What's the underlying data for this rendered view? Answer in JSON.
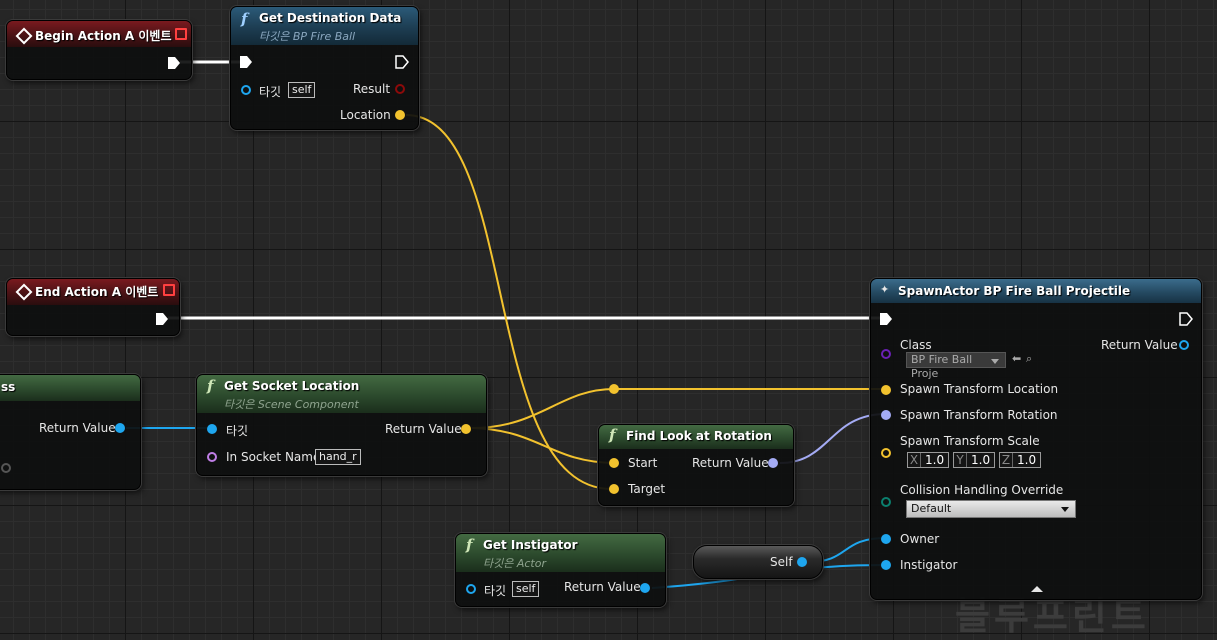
{
  "colors": {
    "exec": "#ffffff",
    "vector": "#f2c22e",
    "rotator": "#a4abf4",
    "object": "#1ea6ef",
    "string": "#c07ee6",
    "class": "#6a20b6",
    "enum": "#0b7f6e",
    "boolean": "#8c0a0a"
  },
  "nodes": {
    "begin_event": {
      "title": "Begin Action A 이벤트"
    },
    "get_destination": {
      "title": "Get Destination Data",
      "subtitle": "타깃은 BP Fire Ball",
      "target_label": "타깃",
      "target_value": "self",
      "result_label": "Result",
      "location_label": "Location"
    },
    "end_event": {
      "title": "End Action A 이벤트"
    },
    "partial": {
      "title": "ss",
      "return_label": "Return Value"
    },
    "get_socket": {
      "title": "Get Socket Location",
      "subtitle": "타깃은 Scene Component",
      "target_label": "타깃",
      "socket_label": "In Socket Name",
      "socket_value": "hand_r",
      "return_label": "Return Value"
    },
    "find_look": {
      "title": "Find Look at Rotation",
      "start_label": "Start",
      "target_label": "Target",
      "return_label": "Return Value"
    },
    "get_instigator": {
      "title": "Get Instigator",
      "subtitle": "타깃은 Actor",
      "target_label": "타깃",
      "target_value": "self",
      "return_label": "Return Value"
    },
    "self_node": {
      "label": "Self"
    },
    "spawn": {
      "title": "SpawnActor BP Fire Ball Projectile",
      "class_label": "Class",
      "class_value": "BP Fire Ball Proje",
      "return_label": "Return Value",
      "location_label": "Spawn Transform Location",
      "rotation_label": "Spawn Transform Rotation",
      "scale_label": "Spawn Transform Scale",
      "scale": {
        "x_label": "X",
        "x": "1.0",
        "y_label": "Y",
        "y": "1.0",
        "z_label": "Z",
        "z": "1.0"
      },
      "collision_label": "Collision Handling Override",
      "collision_value": "Default",
      "owner_label": "Owner",
      "instigator_label": "Instigator"
    }
  },
  "watermark": "블루프린트"
}
